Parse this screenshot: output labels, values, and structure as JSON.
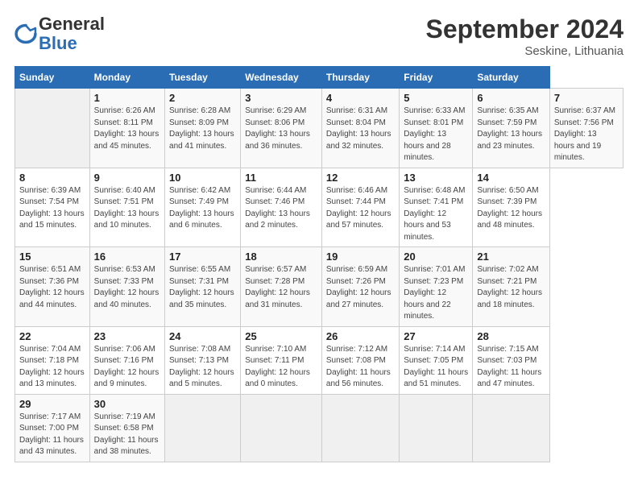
{
  "header": {
    "logo_text_general": "General",
    "logo_text_blue": "Blue",
    "month_title": "September 2024",
    "location": "Seskine, Lithuania"
  },
  "calendar": {
    "days_of_week": [
      "Sunday",
      "Monday",
      "Tuesday",
      "Wednesday",
      "Thursday",
      "Friday",
      "Saturday"
    ],
    "weeks": [
      [
        null,
        {
          "day": "1",
          "sunrise": "Sunrise: 6:26 AM",
          "sunset": "Sunset: 8:11 PM",
          "daylight": "Daylight: 13 hours and 45 minutes."
        },
        {
          "day": "2",
          "sunrise": "Sunrise: 6:28 AM",
          "sunset": "Sunset: 8:09 PM",
          "daylight": "Daylight: 13 hours and 41 minutes."
        },
        {
          "day": "3",
          "sunrise": "Sunrise: 6:29 AM",
          "sunset": "Sunset: 8:06 PM",
          "daylight": "Daylight: 13 hours and 36 minutes."
        },
        {
          "day": "4",
          "sunrise": "Sunrise: 6:31 AM",
          "sunset": "Sunset: 8:04 PM",
          "daylight": "Daylight: 13 hours and 32 minutes."
        },
        {
          "day": "5",
          "sunrise": "Sunrise: 6:33 AM",
          "sunset": "Sunset: 8:01 PM",
          "daylight": "Daylight: 13 hours and 28 minutes."
        },
        {
          "day": "6",
          "sunrise": "Sunrise: 6:35 AM",
          "sunset": "Sunset: 7:59 PM",
          "daylight": "Daylight: 13 hours and 23 minutes."
        },
        {
          "day": "7",
          "sunrise": "Sunrise: 6:37 AM",
          "sunset": "Sunset: 7:56 PM",
          "daylight": "Daylight: 13 hours and 19 minutes."
        }
      ],
      [
        {
          "day": "8",
          "sunrise": "Sunrise: 6:39 AM",
          "sunset": "Sunset: 7:54 PM",
          "daylight": "Daylight: 13 hours and 15 minutes."
        },
        {
          "day": "9",
          "sunrise": "Sunrise: 6:40 AM",
          "sunset": "Sunset: 7:51 PM",
          "daylight": "Daylight: 13 hours and 10 minutes."
        },
        {
          "day": "10",
          "sunrise": "Sunrise: 6:42 AM",
          "sunset": "Sunset: 7:49 PM",
          "daylight": "Daylight: 13 hours and 6 minutes."
        },
        {
          "day": "11",
          "sunrise": "Sunrise: 6:44 AM",
          "sunset": "Sunset: 7:46 PM",
          "daylight": "Daylight: 13 hours and 2 minutes."
        },
        {
          "day": "12",
          "sunrise": "Sunrise: 6:46 AM",
          "sunset": "Sunset: 7:44 PM",
          "daylight": "Daylight: 12 hours and 57 minutes."
        },
        {
          "day": "13",
          "sunrise": "Sunrise: 6:48 AM",
          "sunset": "Sunset: 7:41 PM",
          "daylight": "Daylight: 12 hours and 53 minutes."
        },
        {
          "day": "14",
          "sunrise": "Sunrise: 6:50 AM",
          "sunset": "Sunset: 7:39 PM",
          "daylight": "Daylight: 12 hours and 48 minutes."
        }
      ],
      [
        {
          "day": "15",
          "sunrise": "Sunrise: 6:51 AM",
          "sunset": "Sunset: 7:36 PM",
          "daylight": "Daylight: 12 hours and 44 minutes."
        },
        {
          "day": "16",
          "sunrise": "Sunrise: 6:53 AM",
          "sunset": "Sunset: 7:33 PM",
          "daylight": "Daylight: 12 hours and 40 minutes."
        },
        {
          "day": "17",
          "sunrise": "Sunrise: 6:55 AM",
          "sunset": "Sunset: 7:31 PM",
          "daylight": "Daylight: 12 hours and 35 minutes."
        },
        {
          "day": "18",
          "sunrise": "Sunrise: 6:57 AM",
          "sunset": "Sunset: 7:28 PM",
          "daylight": "Daylight: 12 hours and 31 minutes."
        },
        {
          "day": "19",
          "sunrise": "Sunrise: 6:59 AM",
          "sunset": "Sunset: 7:26 PM",
          "daylight": "Daylight: 12 hours and 27 minutes."
        },
        {
          "day": "20",
          "sunrise": "Sunrise: 7:01 AM",
          "sunset": "Sunset: 7:23 PM",
          "daylight": "Daylight: 12 hours and 22 minutes."
        },
        {
          "day": "21",
          "sunrise": "Sunrise: 7:02 AM",
          "sunset": "Sunset: 7:21 PM",
          "daylight": "Daylight: 12 hours and 18 minutes."
        }
      ],
      [
        {
          "day": "22",
          "sunrise": "Sunrise: 7:04 AM",
          "sunset": "Sunset: 7:18 PM",
          "daylight": "Daylight: 12 hours and 13 minutes."
        },
        {
          "day": "23",
          "sunrise": "Sunrise: 7:06 AM",
          "sunset": "Sunset: 7:16 PM",
          "daylight": "Daylight: 12 hours and 9 minutes."
        },
        {
          "day": "24",
          "sunrise": "Sunrise: 7:08 AM",
          "sunset": "Sunset: 7:13 PM",
          "daylight": "Daylight: 12 hours and 5 minutes."
        },
        {
          "day": "25",
          "sunrise": "Sunrise: 7:10 AM",
          "sunset": "Sunset: 7:11 PM",
          "daylight": "Daylight: 12 hours and 0 minutes."
        },
        {
          "day": "26",
          "sunrise": "Sunrise: 7:12 AM",
          "sunset": "Sunset: 7:08 PM",
          "daylight": "Daylight: 11 hours and 56 minutes."
        },
        {
          "day": "27",
          "sunrise": "Sunrise: 7:14 AM",
          "sunset": "Sunset: 7:05 PM",
          "daylight": "Daylight: 11 hours and 51 minutes."
        },
        {
          "day": "28",
          "sunrise": "Sunrise: 7:15 AM",
          "sunset": "Sunset: 7:03 PM",
          "daylight": "Daylight: 11 hours and 47 minutes."
        }
      ],
      [
        {
          "day": "29",
          "sunrise": "Sunrise: 7:17 AM",
          "sunset": "Sunset: 7:00 PM",
          "daylight": "Daylight: 11 hours and 43 minutes."
        },
        {
          "day": "30",
          "sunrise": "Sunrise: 7:19 AM",
          "sunset": "Sunset: 6:58 PM",
          "daylight": "Daylight: 11 hours and 38 minutes."
        },
        null,
        null,
        null,
        null,
        null
      ]
    ]
  }
}
